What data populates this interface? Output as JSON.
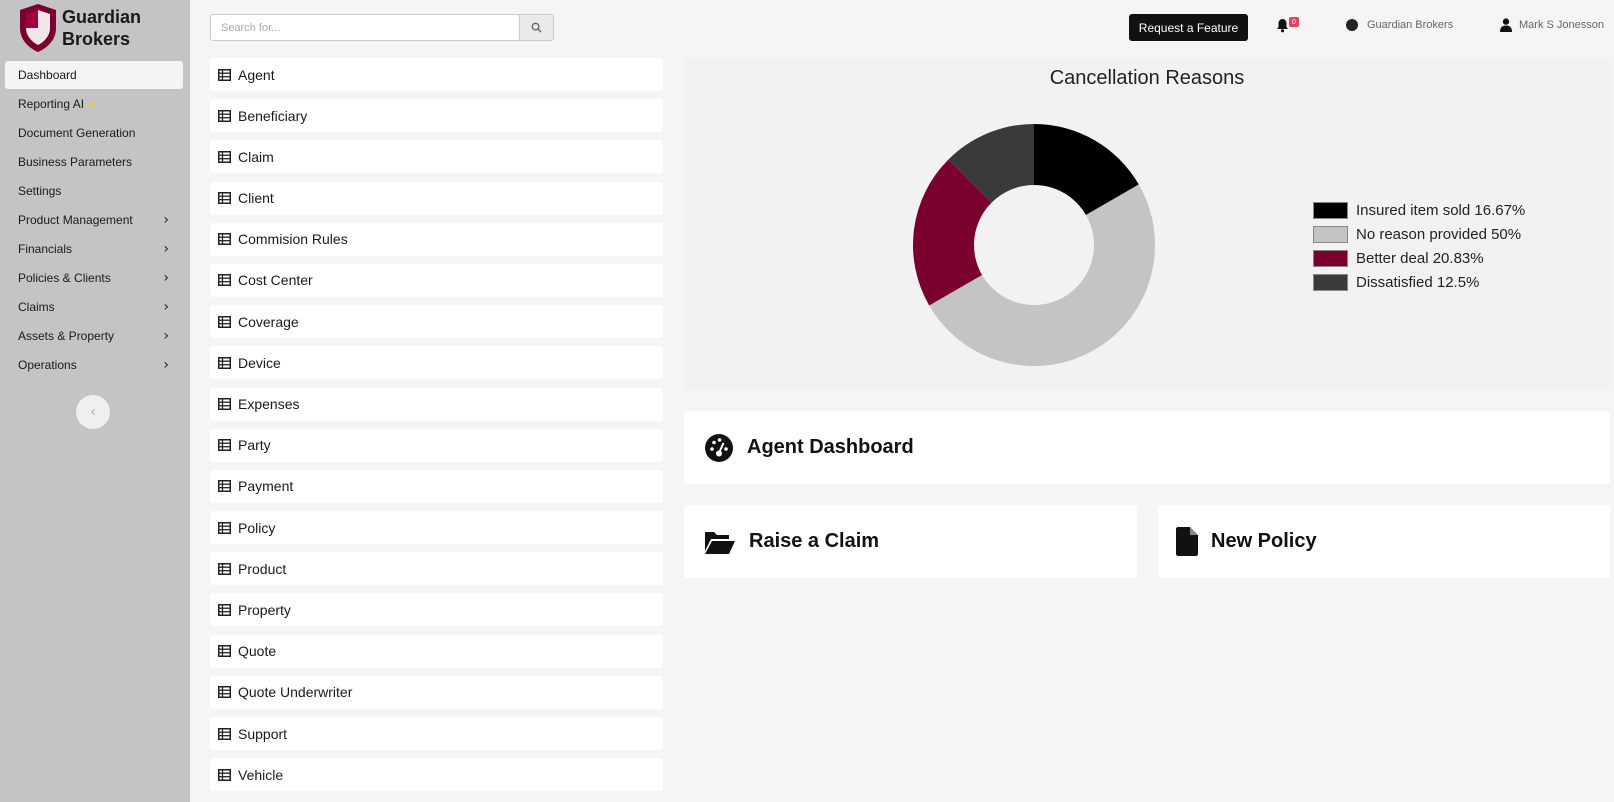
{
  "brand": {
    "name_line1": "Guardian",
    "name_line2": "Brokers"
  },
  "sidebar": {
    "items": [
      {
        "label": "Dashboard",
        "active": true,
        "chevron": false
      },
      {
        "label": "Reporting AI",
        "star": true,
        "chevron": false
      },
      {
        "label": "Document Generation",
        "chevron": false
      },
      {
        "label": "Business Parameters",
        "chevron": false
      },
      {
        "label": "Settings",
        "chevron": false
      },
      {
        "label": "Product Management",
        "chevron": true
      },
      {
        "label": "Financials",
        "chevron": true
      },
      {
        "label": "Policies & Clients",
        "chevron": true
      },
      {
        "label": "Claims",
        "chevron": true
      },
      {
        "label": "Assets & Property",
        "chevron": true
      },
      {
        "label": "Operations",
        "chevron": true
      }
    ],
    "star_glyph": "★",
    "chevron_glyph": "›",
    "collapse_glyph": "‹"
  },
  "search": {
    "placeholder": "Search for...",
    "value": ""
  },
  "entities": [
    "Agent",
    "Beneficiary",
    "Claim",
    "Client",
    "Commision Rules",
    "Cost Center",
    "Coverage",
    "Device",
    "Expenses",
    "Party",
    "Payment",
    "Policy",
    "Product",
    "Property",
    "Quote",
    "Quote Underwriter",
    "Support",
    "Vehicle"
  ],
  "header": {
    "feature_button": "Request a Feature",
    "notification_count": "0",
    "org_name": "Guardian Brokers",
    "user_name": "Mark S Jonesson"
  },
  "chart_data": {
    "type": "pie",
    "title": "Cancellation Reasons",
    "donut": true,
    "slices": [
      {
        "label": "Insured item sold",
        "value": 16.67,
        "legend": "Insured item sold 16.67%",
        "color": "#000000"
      },
      {
        "label": "No reason provided",
        "value": 50,
        "legend": "No reason provided 50%",
        "color": "#c4c4c4"
      },
      {
        "label": "Better deal",
        "value": 20.83,
        "legend": "Better deal 20.83%",
        "color": "#7a0030"
      },
      {
        "label": "Dissatisfied",
        "value": 12.5,
        "legend": "Dissatisfied 12.5%",
        "color": "#3a3a3a"
      }
    ],
    "legend_position": "right"
  },
  "cards": {
    "agent_dashboard": "Agent Dashboard",
    "raise_claim": "Raise a Claim",
    "new_policy": "New Policy"
  },
  "icons": {
    "brand_shield": "shield-icon",
    "table": "table-icon",
    "search": "search-icon",
    "bell": "bell-icon",
    "user": "user-icon",
    "agent_dashboard": "gauge-icon",
    "raise_claim": "folder-open-icon",
    "new_policy": "file-icon"
  },
  "colors": {
    "accent": "#7a0030",
    "sidebar_bg": "#c4c4c4",
    "badge": "#e0445f"
  }
}
